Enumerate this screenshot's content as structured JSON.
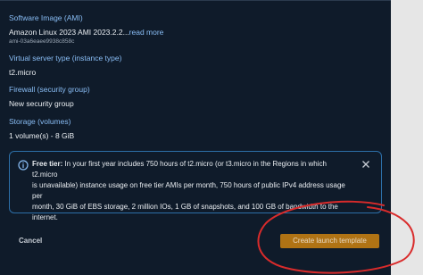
{
  "summary": {
    "software_image": {
      "label": "Software Image (AMI)",
      "value_text": "Amazon Linux 2023 AMI 2023.2.2...",
      "read_more": "read more",
      "ami_id": "ami-03a6eaee9938c858c"
    },
    "instance_type": {
      "label": "Virtual server type (instance type)",
      "value": "t2.micro"
    },
    "firewall": {
      "label": "Firewall (security group)",
      "value": "New security group"
    },
    "storage": {
      "label": "Storage (volumes)",
      "value": "1 volume(s) - 8 GiB"
    }
  },
  "free_tier": {
    "title": "Free tier:",
    "lines": [
      " In your first year includes 750 hours of t2.micro (or t3.micro in the Regions in which t2.micro",
      "is unavailable) instance usage on free tier AMIs per month, 750 hours of public IPv4 address usage per",
      "month, 30 GiB of EBS storage, 2 million IOs, 1 GB of snapshots, and 100 GB of bandwidth to the",
      "internet."
    ],
    "icons": {
      "info": "info-icon",
      "close": "close-icon"
    }
  },
  "actions": {
    "cancel_label": "Cancel",
    "launch_label": "Create launch template"
  },
  "colors": {
    "background": "#0f1b2a",
    "label": "#89bdf5",
    "primary_button": "#b07314",
    "annotation": "#d92b2b"
  }
}
